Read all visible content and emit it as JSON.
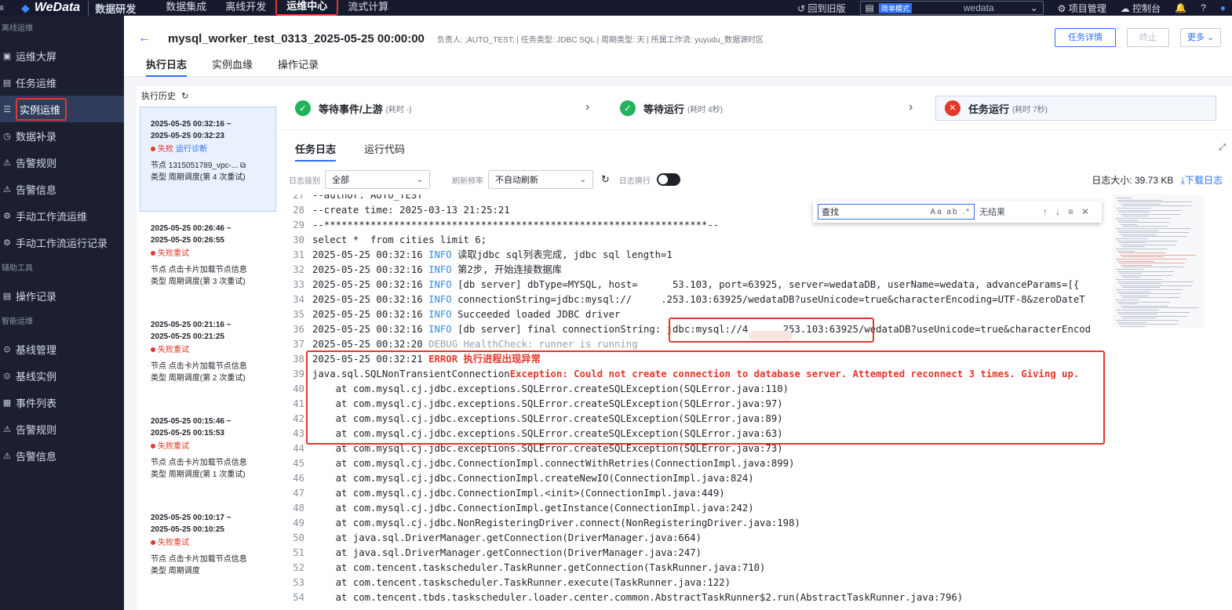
{
  "topnav": {
    "brand": "WeData",
    "brand_sub": "数据研发",
    "items": [
      "数据集成",
      "离线开发",
      "运维中心",
      "流式计算"
    ],
    "active": "运维中心",
    "back_old": "回到旧版",
    "mode_tag": "简单模式",
    "workspace": "wedata",
    "project_mgmt": "项目管理",
    "console": "控制台"
  },
  "sidebar": {
    "sections": [
      {
        "title": "离线运维",
        "items": [
          {
            "icon": "▣",
            "label": "运维大屏"
          },
          {
            "icon": "▤",
            "label": "任务运维"
          },
          {
            "icon": "☰",
            "label": "实例运维",
            "active": true
          },
          {
            "icon": "◷",
            "label": "数据补录"
          },
          {
            "icon": "⚠",
            "label": "告警规则"
          },
          {
            "icon": "⚠",
            "label": "告警信息"
          },
          {
            "icon": "⚙",
            "label": "手动工作流运维"
          },
          {
            "icon": "⚙",
            "label": "手动工作流运行记录"
          }
        ]
      },
      {
        "title": "辅助工具",
        "items": [
          {
            "icon": "▤",
            "label": "操作记录"
          }
        ]
      },
      {
        "title": "智能运维",
        "items": [
          {
            "icon": "⊙",
            "label": "基线管理"
          },
          {
            "icon": "⊙",
            "label": "基线实例"
          },
          {
            "icon": "▦",
            "label": "事件列表"
          },
          {
            "icon": "⚠",
            "label": "告警规则"
          },
          {
            "icon": "⚠",
            "label": "告警信息"
          }
        ]
      }
    ]
  },
  "header": {
    "back_icon": "←",
    "title": "mysql_worker_test_0313_2025-05-25 00:00:00",
    "meta": "负责人: ;AUTO_TEST; | 任务类型: JDBC SQL | 周期类型: 天 | 所属工作流: yuyudu_数据源时区",
    "btn_detail": "任务详情",
    "btn_stop": "终止",
    "btn_more": "更多 ⌄",
    "tabs": [
      "执行日志",
      "实例血缘",
      "操作记录"
    ]
  },
  "history": {
    "title": "执行历史",
    "records": [
      {
        "time": "2025-05-25 00:32:16 ~ 2025-05-25 00:32:23",
        "status": "失败",
        "diag": "运行诊断",
        "node": "节点 1315051789_vpc-...",
        "type": "类型 周期调度(第 4 次重试)"
      },
      {
        "time": "2025-05-25 00:26:46 ~ 2025-05-25 00:26:55",
        "status": "失败重试",
        "node": "节点 点击卡片加载节点信息",
        "type": "类型 周期调度(第 3 次重试)"
      },
      {
        "time": "2025-05-25 00:21:16 ~ 2025-05-25 00:21:25",
        "status": "失败重试",
        "node": "节点 点击卡片加载节点信息",
        "type": "类型 周期调度(第 2 次重试)"
      },
      {
        "time": "2025-05-25 00:15:46 ~ 2025-05-25 00:15:53",
        "status": "失败重试",
        "node": "节点 点击卡片加载节点信息",
        "type": "类型 周期调度(第 1 次重试)"
      },
      {
        "time": "2025-05-25 00:10:17 ~ 2025-05-25 00:10:25",
        "status": "失败重试",
        "node": "节点 点击卡片加载节点信息",
        "type": "类型 周期调度"
      }
    ]
  },
  "stages": [
    {
      "label": "等待事件/上游",
      "cost": "(耗时 -)"
    },
    {
      "label": "等待运行",
      "cost": "(耗时 4秒)"
    },
    {
      "label": "任务运行",
      "cost": "(耗时 7秒)"
    }
  ],
  "subtabs": [
    "任务日志",
    "运行代码"
  ],
  "toolbar": {
    "level_label": "日志级别",
    "level_value": "全部",
    "refresh_label": "刷新频率",
    "refresh_value": "不自动刷新",
    "wrap_label": "日志换行",
    "size_label": "日志大小:",
    "size_value": "39.73 KB",
    "download": "下载日志"
  },
  "search": {
    "placeholder": "查找",
    "options": "Aa ab .*",
    "no_result": "无结果"
  },
  "log_lines": [
    {
      "n": "27",
      "parts": [
        {
          "t": "--author: AUTO_TEST"
        }
      ]
    },
    {
      "n": "28",
      "parts": [
        {
          "t": "--create time: 2025-03-13 21:25:21"
        }
      ]
    },
    {
      "n": "29",
      "parts": [
        {
          "t": "--******************************************************************--"
        }
      ]
    },
    {
      "n": "30",
      "parts": [
        {
          "t": "select *  from cities limit 6;"
        }
      ]
    },
    {
      "n": "31",
      "parts": [
        {
          "t": "2025-05-25 00:32:16 "
        },
        {
          "t": "INFO",
          "c": "info"
        },
        {
          "t": " 读取jdbc sql列表完成, jdbc sql length=1"
        }
      ]
    },
    {
      "n": "32",
      "parts": [
        {
          "t": "2025-05-25 00:32:16 "
        },
        {
          "t": "INFO",
          "c": "info"
        },
        {
          "t": " 第2步, 开始连接数据库"
        }
      ]
    },
    {
      "n": "33",
      "parts": [
        {
          "t": "2025-05-25 00:32:16 "
        },
        {
          "t": "INFO",
          "c": "info"
        },
        {
          "t": " [db server] dbType=MYSQL, host=      53.103, port=63925, server=wedataDB, userName=wedata, advanceParams=[{"
        }
      ]
    },
    {
      "n": "34",
      "parts": [
        {
          "t": "2025-05-25 00:32:16 "
        },
        {
          "t": "INFO",
          "c": "info"
        },
        {
          "t": " connectionString=jdbc:mysql://     .253.103:63925/wedataDB?useUnicode=true&characterEncoding=UTF-8&zeroDateT"
        }
      ]
    },
    {
      "n": "35",
      "parts": [
        {
          "t": "2025-05-25 00:32:16 "
        },
        {
          "t": "INFO",
          "c": "info"
        },
        {
          "t": " Succeeded loaded JDBC driver"
        }
      ]
    },
    {
      "n": "36",
      "parts": [
        {
          "t": "2025-05-25 00:32:16 "
        },
        {
          "t": "INFO",
          "c": "info"
        },
        {
          "t": " [db server] final connectionString: jdbc:mysql://4      253.103:63925/wedataDB?useUnicode=true&characterEncod"
        }
      ]
    },
    {
      "n": "37",
      "parts": [
        {
          "t": "2025-05-25 00:32:20 "
        },
        {
          "t": "DEBUG HealthCheck: runner is running",
          "c": "debug"
        }
      ]
    },
    {
      "n": "38",
      "parts": [
        {
          "t": "2025-05-25 00:32:21 "
        },
        {
          "t": "ERROR 执行进程出现异常",
          "c": "err"
        }
      ]
    },
    {
      "n": "39",
      "parts": [
        {
          "t": "java.sql.SQLNonTransientConnection"
        },
        {
          "t": "Exception: Could not create connection to database server. Attempted reconnect 3 times. Giving up.",
          "c": "err"
        }
      ]
    },
    {
      "n": "40",
      "parts": [
        {
          "t": "    at com.mysql.cj.jdbc.exceptions.SQLError.createSQLException(SQLError.java:110)"
        }
      ]
    },
    {
      "n": "41",
      "parts": [
        {
          "t": "    at com.mysql.cj.jdbc.exceptions.SQLError.createSQLException(SQLError.java:97)"
        }
      ]
    },
    {
      "n": "42",
      "parts": [
        {
          "t": "    at com.mysql.cj.jdbc.exceptions.SQLError.createSQLException(SQLError.java:89)"
        }
      ]
    },
    {
      "n": "43",
      "parts": [
        {
          "t": "    at com.mysql.cj.jdbc.exceptions.SQLError.createSQLException(SQLError.java:63)"
        }
      ]
    },
    {
      "n": "44",
      "parts": [
        {
          "t": "    at com.mysql.cj.jdbc.exceptions.SQLError.createSQLException(SQLError.java:73)"
        }
      ]
    },
    {
      "n": "45",
      "parts": [
        {
          "t": "    at com.mysql.cj.jdbc.ConnectionImpl.connectWithRetries(ConnectionImpl.java:899)"
        }
      ]
    },
    {
      "n": "46",
      "parts": [
        {
          "t": "    at com.mysql.cj.jdbc.ConnectionImpl.createNewIO(ConnectionImpl.java:824)"
        }
      ]
    },
    {
      "n": "47",
      "parts": [
        {
          "t": "    at com.mysql.cj.jdbc.ConnectionImpl.<init>(ConnectionImpl.java:449)"
        }
      ]
    },
    {
      "n": "48",
      "parts": [
        {
          "t": "    at com.mysql.cj.jdbc.ConnectionImpl.getInstance(ConnectionImpl.java:242)"
        }
      ]
    },
    {
      "n": "49",
      "parts": [
        {
          "t": "    at com.mysql.cj.jdbc.NonRegisteringDriver.connect(NonRegisteringDriver.java:198)"
        }
      ]
    },
    {
      "n": "50",
      "parts": [
        {
          "t": "    at java.sql.DriverManager.getConnection(DriverManager.java:664)"
        }
      ]
    },
    {
      "n": "51",
      "parts": [
        {
          "t": "    at java.sql.DriverManager.getConnection(DriverManager.java:247)"
        }
      ]
    },
    {
      "n": "52",
      "parts": [
        {
          "t": "    at com.tencent.taskscheduler.TaskRunner.getConnection(TaskRunner.java:710)"
        }
      ]
    },
    {
      "n": "53",
      "parts": [
        {
          "t": "    at com.tencent.taskscheduler.TaskRunner.execute(TaskRunner.java:122)"
        }
      ]
    },
    {
      "n": "54",
      "parts": [
        {
          "t": "    at com.tencent.tbds.taskscheduler.loader.center.common.AbstractTaskRunner$2.run(AbstractTaskRunner.java:796)"
        }
      ]
    }
  ],
  "colors": {
    "accent": "#2d6ff5",
    "success": "#20b359",
    "error": "#e5372a",
    "sidebar_bg": "#1b1f30",
    "info": "#2d8cf0"
  },
  "icons": {
    "back": "arrow-left-icon",
    "refresh": "refresh-icon",
    "check": "check-circle-icon",
    "fail": "close-circle-icon",
    "download": "download-icon",
    "expand": "expand-icon"
  }
}
